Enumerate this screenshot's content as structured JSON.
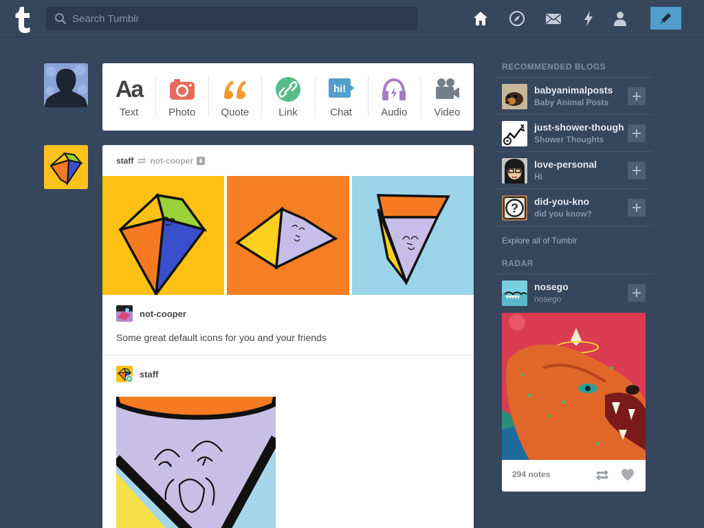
{
  "header": {
    "search_placeholder": "Search Tumblr",
    "nav": [
      "home-icon",
      "explore-icon",
      "inbox-icon",
      "activity-icon",
      "account-icon"
    ],
    "compose": "pencil-icon"
  },
  "post_types": [
    {
      "label": "Text",
      "glyph": "Aa",
      "color": "#444444"
    },
    {
      "label": "Photo",
      "color": "#e66b5a"
    },
    {
      "label": "Quote",
      "glyph": "❛❛",
      "color": "#f2992e"
    },
    {
      "label": "Link",
      "color": "#56bc8a"
    },
    {
      "label": "Chat",
      "glyph": "hi!",
      "color": "#529ecc"
    },
    {
      "label": "Audio",
      "color": "#a77dc2"
    },
    {
      "label": "Video",
      "color": "#748089"
    }
  ],
  "post": {
    "author": "staff",
    "reblogged_from": "not-cooper",
    "reblog_blog": "not-cooper",
    "caption": "Some great default icons for you and your friends",
    "staff_name": "staff"
  },
  "sidebar": {
    "recommended_heading": "Recommended Blogs",
    "blogs": [
      {
        "name": "babyanimalposts",
        "title": "Baby Animal Posts"
      },
      {
        "name": "just-shower-thoughts",
        "title": "Shower Thoughts"
      },
      {
        "name": "love-personal",
        "title": "Hi"
      },
      {
        "name": "did-you-kno",
        "title": "did you know?"
      }
    ],
    "explore": "Explore all of Tumblr",
    "radar_heading": "Radar",
    "radar": {
      "name": "nosego",
      "title": "nosego",
      "notes": "294 notes"
    }
  },
  "colors": {
    "background": "#36465d",
    "accent": "#529ecc"
  }
}
